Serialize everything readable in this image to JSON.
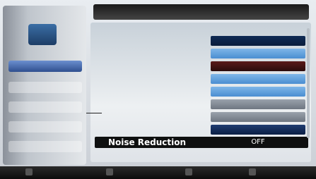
{
  "window": {
    "title": "",
    "focused_row": {
      "label": "Noise Reduction",
      "value": "OFF"
    }
  },
  "colors": {
    "focus_row_bg": "#0f1010",
    "focus_text": "#ffffff",
    "selected_nav": "#2f4f8f"
  }
}
